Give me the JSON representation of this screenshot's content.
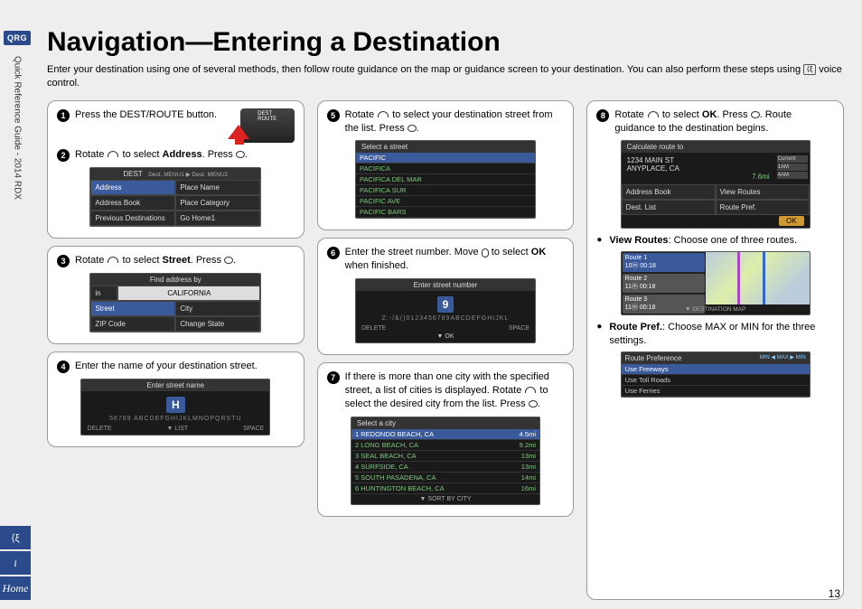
{
  "sidebar": {
    "badge": "QRG",
    "vertical_text": "Quick Reference Guide - 2014 RDX",
    "icons": {
      "voice_label": "⟨ξ",
      "info_label": "i",
      "home_label": "Home"
    }
  },
  "title": "Navigation—Entering a Destination",
  "intro_a": "Enter your destination using one of several methods, then follow route guidance on the map or guidance screen to your destination. You can also perform these steps using ",
  "intro_b": " voice control.",
  "page_number": "13",
  "col1": {
    "step1": {
      "num": "1",
      "text_a": "Press the DEST/ROUTE button.",
      "btn_label": "DEST\nROUTE"
    },
    "step2": {
      "num": "2",
      "text_a": "Rotate ",
      "text_b": " to select ",
      "bold": "Address",
      "text_c": ". Press ",
      "shot": {
        "header": "DEST",
        "tabs": "Dest. MENU1 ▶ Dest. MENU2",
        "cells": [
          [
            "Address",
            "Place Name"
          ],
          [
            "Address Book",
            "Place Category"
          ],
          [
            "Previous Destinations",
            "Go Home1"
          ]
        ],
        "hl_row": 0,
        "hl_col": 0
      }
    },
    "step3": {
      "num": "3",
      "text_a": "Rotate ",
      "text_b": " to select ",
      "bold": "Street",
      "text_c": ". Press ",
      "shot": {
        "header": "Find address by",
        "state_label": "in",
        "state": "CALIFORNIA",
        "cells": [
          [
            "Street",
            "City"
          ],
          [
            "ZIP Code",
            "Change State"
          ]
        ],
        "hl_row": 0,
        "hl_col": 0
      }
    },
    "step4": {
      "num": "4",
      "text": "Enter the name of your destination street.",
      "shot": {
        "header": "Enter street name",
        "hl_char": "H",
        "row": "56789 ABCDEFGHIJKLMNOPQRSTU",
        "footer_l": "DELETE",
        "footer_r": "SPACE",
        "footer_list": "LIST"
      }
    }
  },
  "col2": {
    "step5": {
      "num": "5",
      "text_a": "Rotate ",
      "text_b": " to select your destination street from the list. Press ",
      "shot": {
        "header": "Select a street",
        "items": [
          "PACIFIC",
          "PACIFICA",
          "PACIFICA DEL MAR",
          "PACIFICA SUR",
          "PACIFIC AVE",
          "PACIFIC BARS"
        ],
        "hl": 0
      }
    },
    "step6": {
      "num": "6",
      "text_a": "Enter the street number. Move ",
      "text_b": " to select ",
      "bold": "OK",
      "text_c": " when finished.",
      "shot": {
        "header": "Enter street number",
        "digit": "9",
        "row": "Z:-/&()0123456789ABCDEFGHIJKL",
        "footer_l": "DELETE",
        "footer_r": "SPACE",
        "ok": "OK"
      }
    },
    "step7": {
      "num": "7",
      "text_a": "If there is more than one city with the specified street, a list of cities is displayed. Rotate ",
      "text_b": " to select the desired city from the list. Press ",
      "shot": {
        "header": "Select a city",
        "items": [
          {
            "n": "REDONDO BEACH, CA",
            "d": "4.5mi"
          },
          {
            "n": "LONG BEACH, CA",
            "d": "9.2mi"
          },
          {
            "n": "SEAL BEACH, CA",
            "d": "13mi"
          },
          {
            "n": "SURFSIDE, CA",
            "d": "13mi"
          },
          {
            "n": "SOUTH PASADENA, CA",
            "d": "14mi"
          },
          {
            "n": "HUNTINGTON BEACH, CA",
            "d": "16mi"
          }
        ],
        "hl": 0,
        "footer": "SORT BY CITY"
      }
    }
  },
  "col3": {
    "step8": {
      "num": "8",
      "text_a": "Rotate ",
      "text_b": " to select ",
      "bold": "OK",
      "text_c": ". Press ",
      "text_d": ". Route guidance to the destination begins.",
      "shot": {
        "header": "Calculate route to",
        "addr1": "1234 MAIN ST",
        "addr2": "ANYPLACE, CA",
        "dist": "7.6mi",
        "times": [
          "Current",
          "1AM",
          "4AM"
        ],
        "cells": [
          [
            "Address Book",
            "View Routes"
          ],
          [
            "Dest. List",
            "Route Pref."
          ]
        ],
        "ok": "OK"
      }
    },
    "bullet1": {
      "bold": "View Routes",
      "text": ": Choose one of three routes."
    },
    "map_shot": {
      "routes": [
        {
          "n": "Route 1",
          "t": "10ⓜ 00:18"
        },
        {
          "n": "Route 2",
          "t": "11ⓜ 00:18"
        },
        {
          "n": "Route 3",
          "t": "11ⓜ 00:18"
        }
      ],
      "footer": "DESTINATION MAP"
    },
    "bullet2": {
      "bold": "Route Pref.",
      "text": ": Choose MAX or MIN for the three settings."
    },
    "pref_shot": {
      "header": "Route Preference",
      "badge": "MIN ◀ MAX ▶ MIN",
      "items": [
        "Use Freeways",
        "Use Toll Roads",
        "Use Ferries"
      ]
    }
  }
}
